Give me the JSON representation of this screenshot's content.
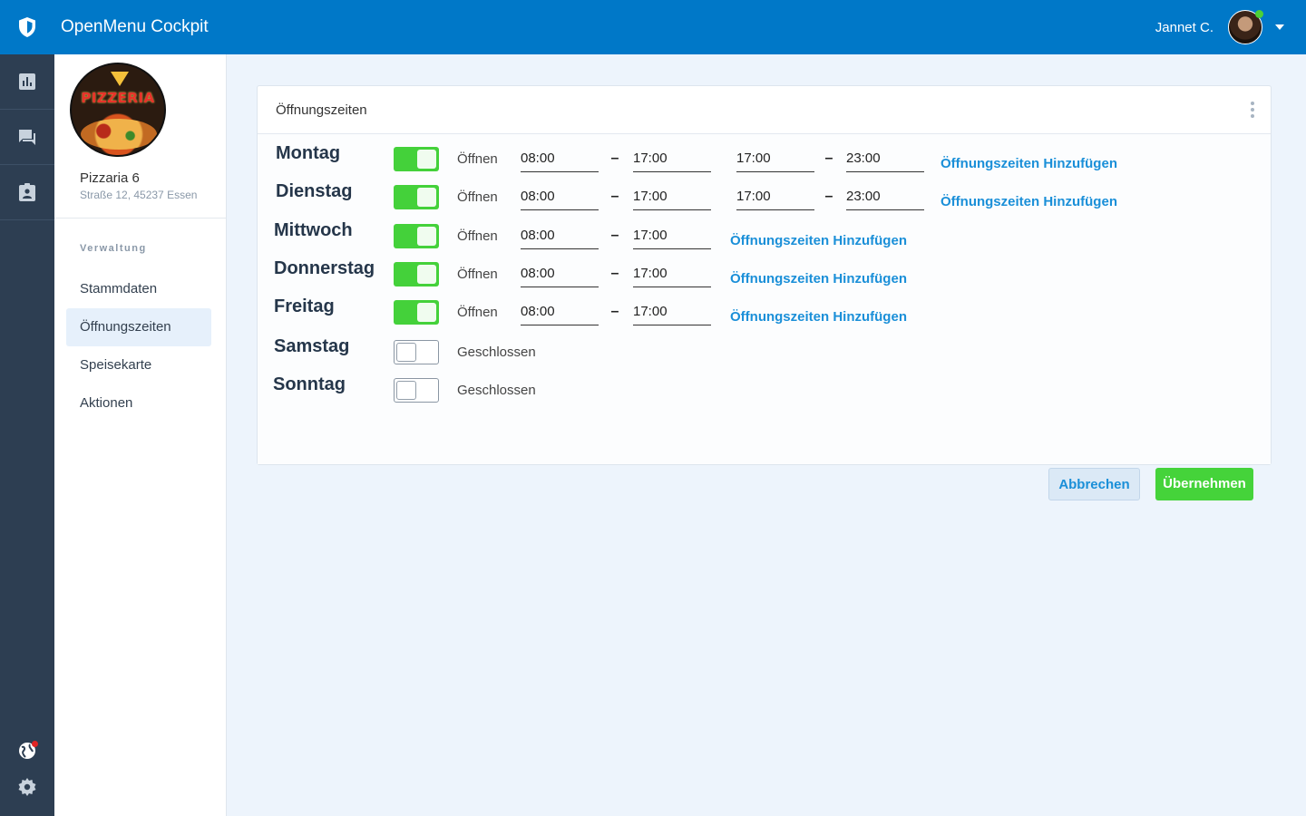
{
  "header": {
    "app_title": "OpenMenu Cockpit",
    "user_name": "Jannet C."
  },
  "rail": {
    "items": [
      "chart-icon",
      "chat-icon",
      "clipboard-icon"
    ],
    "bottom": [
      "globe-icon",
      "gear-icon"
    ]
  },
  "store": {
    "logo_text": "PIZZERIA",
    "name": "Pizzaria 6",
    "address": "Straße 12, 45237 Essen"
  },
  "sidebar": {
    "section_label": "Verwaltung",
    "items": [
      {
        "label": "Stammdaten",
        "active": false
      },
      {
        "label": "Öffnungszeiten",
        "active": true
      },
      {
        "label": "Speisekarte",
        "active": false
      },
      {
        "label": "Aktionen",
        "active": false
      }
    ]
  },
  "card": {
    "title": "Öffnungszeiten",
    "days": [
      {
        "day": "Montag",
        "open": true,
        "status": "Öffnen",
        "ranges": [
          [
            "08:00",
            "17:00"
          ],
          [
            "17:00",
            "23:00"
          ]
        ],
        "add_label": "Öffnungszeiten Hinzufügen"
      },
      {
        "day": "Dienstag",
        "open": true,
        "status": "Öffnen",
        "ranges": [
          [
            "08:00",
            "17:00"
          ],
          [
            "17:00",
            "23:00"
          ]
        ],
        "add_label": "Öffnungszeiten Hinzufügen"
      },
      {
        "day": "Mittwoch",
        "open": true,
        "status": "Öffnen",
        "ranges": [
          [
            "08:00",
            "17:00"
          ]
        ],
        "add_label": "Öffnungszeiten Hinzufügen"
      },
      {
        "day": "Donnerstag",
        "open": true,
        "status": "Öffnen",
        "ranges": [
          [
            "08:00",
            "17:00"
          ]
        ],
        "add_label": "Öffnungszeiten Hinzufügen"
      },
      {
        "day": "Freitag",
        "open": true,
        "status": "Öffnen",
        "ranges": [
          [
            "08:00",
            "17:00"
          ]
        ],
        "add_label": "Öffnungszeiten Hinzufügen"
      },
      {
        "day": "Samstag",
        "open": false,
        "status": "Geschlossen",
        "ranges": [],
        "add_label": ""
      },
      {
        "day": "Sonntag",
        "open": false,
        "status": "Geschlossen",
        "ranges": [],
        "add_label": ""
      }
    ],
    "cancel_label": "Abbrechen",
    "apply_label": "Übernehmen"
  },
  "colors": {
    "topbar": "#0078c8",
    "rail": "#2d3e52",
    "toggle_on": "#44d13a",
    "link": "#1a8fd8",
    "apply": "#45d33a"
  }
}
